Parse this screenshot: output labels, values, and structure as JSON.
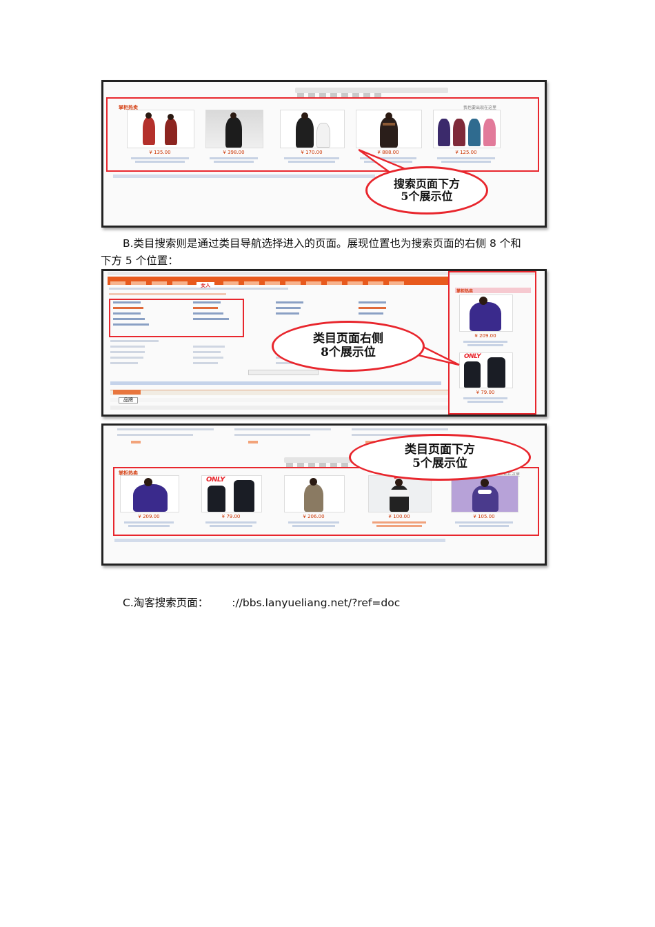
{
  "shot1": {
    "tag": "掌柜热卖",
    "tag_right": "我也要出现在这里",
    "products": [
      {
        "price": "¥ 135.00"
      },
      {
        "price": "¥ 398.00"
      },
      {
        "price": "¥ 170.00"
      },
      {
        "price": "¥ 888.00"
      },
      {
        "price": "¥ 125.00"
      }
    ],
    "callout": [
      "搜索页面下方",
      "5个展示位"
    ]
  },
  "paragraph_b": {
    "line1": "B.类目搜索则是通过类目导航选择进入的页面。展现位置也为搜索页面的右侧 8 个和",
    "line2": "下方 5 个位置："
  },
  "shot2": {
    "active_tab": "女人",
    "side_tag": "掌柜热卖",
    "side_products": [
      {
        "price": "¥ 209.00"
      },
      {
        "price": "¥ 79.00",
        "brand": "ONLY"
      }
    ],
    "search_box": "品牌",
    "callout": [
      "类目页面右侧",
      "8个展示位"
    ]
  },
  "shot3": {
    "tag": "掌柜热卖",
    "tag_right": "我也要出现在这里",
    "products": [
      {
        "price": "¥ 209.00"
      },
      {
        "price": "¥ 79.00",
        "brand": "ONLY"
      },
      {
        "price": "¥ 206.00"
      },
      {
        "price": "¥ 100.00"
      },
      {
        "price": "¥ 105.00"
      }
    ],
    "callout": [
      "类目页面下方",
      "5个展示位"
    ]
  },
  "paragraph_c": {
    "label": "C.淘客搜索页面：",
    "url": "://bbs.lanyueliang.net/?ref=doc"
  }
}
